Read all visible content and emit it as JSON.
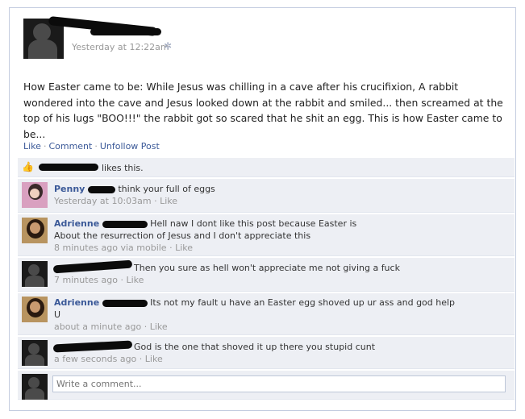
{
  "post": {
    "timestamp": "Yesterday at 12:22am",
    "text": "How Easter came to be: While Jesus was chilling in a cave after his crucifixion, A rabbit wondered into the cave and Jesus looked down at the rabbit and smiled... then screamed at the top of his lugs \"BOO!!!\" the rabbit got so scared that he shit an egg. This is how Easter came to be...",
    "actions": {
      "like": "Like",
      "comment": "Comment",
      "unfollow": "Unfollow Post",
      "separator": "·"
    }
  },
  "likes": {
    "text": "likes this."
  },
  "comments": [
    {
      "name": "Penny",
      "text": "think your full of eggs",
      "meta": "Yesterday at 10:03am",
      "like": "Like"
    },
    {
      "name": "Adrienne",
      "text": "Hell naw I dont like this post because Easter is",
      "text2": "About the resurrection of Jesus and I don't appreciate this",
      "meta": "8 minutes ago via mobile",
      "like": "Like"
    },
    {
      "name": "",
      "text": "Then you sure as hell won't appreciate me not giving a fuck",
      "meta": "7 minutes ago",
      "like": "Like"
    },
    {
      "name": "Adrienne",
      "text": "Its not my fault u have an Easter egg shoved up ur ass and god help",
      "text2": "U",
      "meta": "about a minute ago",
      "like": "Like"
    },
    {
      "name": "",
      "text": "God is the one that shoved it up there you stupid cunt",
      "meta": "a few seconds ago",
      "like": "Like"
    }
  ],
  "composer": {
    "placeholder": "Write a comment..."
  },
  "icons": {
    "gear": "gear-icon",
    "thumb": "thumbs-up-icon"
  },
  "colors": {
    "link": "#3b5998",
    "comment_bg": "#edeff4",
    "border": "#c4cde0"
  }
}
